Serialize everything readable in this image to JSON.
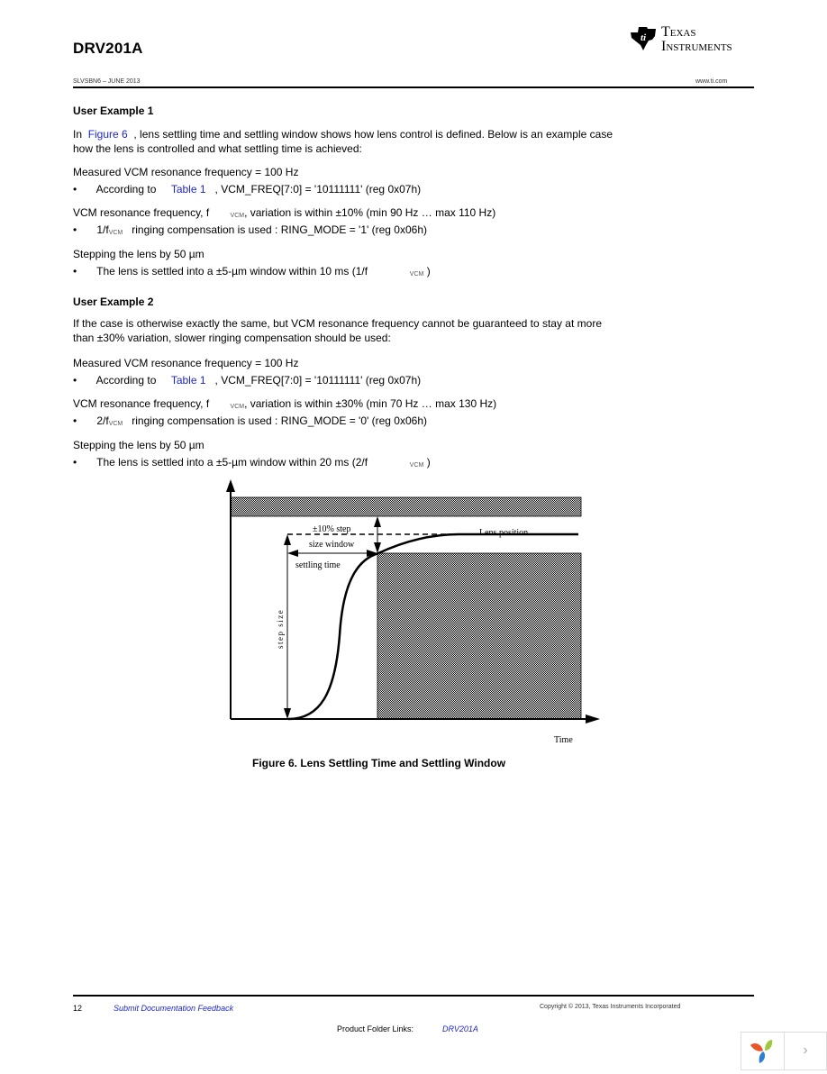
{
  "header": {
    "title": "DRV201A",
    "doc_id": "SLVSBN6 – JUNE 2013",
    "website": "www.ti.com",
    "logo": {
      "icon": "ti-logo-icon",
      "line1": "Texas",
      "line2": "Instruments"
    }
  },
  "example1": {
    "heading": "User Example 1",
    "intro_pre": "In",
    "intro_link": "Figure 6",
    "intro_post": ", lens settling time and settling window shows how lens control is defined. Below is an example case",
    "intro_line2": "how the lens is controlled and what settling time is achieved:",
    "measured": "Measured VCM resonance frequency = 100 Hz",
    "bullet1_pre": "According to",
    "bullet1_link": "Table 1",
    "bullet1_post": ", VCM_FREQ[7:0] = '10111111' (reg 0x07h)",
    "variation_pre": "VCM resonance frequency, f",
    "variation_sub": "VCM",
    "variation_post": ", variation is within ±10% (min 90 Hz … max 110 Hz)",
    "bullet2_pre": "1/f",
    "bullet2_sub": "VCM",
    "bullet2_post": "ringing compensation is used : RING_MODE = '1' (reg 0x06h)",
    "stepping": "Stepping the lens by 50 µm",
    "bullet3_pre": "The lens is settled into a ±5-µm window within 10 ms (1/f",
    "bullet3_sub": "VCM",
    "bullet3_post": ")"
  },
  "example2": {
    "heading": "User Example 2",
    "intro_line1": "If the case is otherwise exactly the same, but VCM resonance frequency cannot be guaranteed to stay at more",
    "intro_line2": "than ±30% variation, slower ringing compensation should be used:",
    "measured": "Measured VCM resonance frequency = 100 Hz",
    "bullet1_pre": "According to",
    "bullet1_link": "Table 1",
    "bullet1_post": ", VCM_FREQ[7:0] = '10111111' (reg 0x07h)",
    "variation_pre": "VCM resonance frequency, f",
    "variation_sub": "VCM",
    "variation_post": ", variation is within ±30% (min 70 Hz … max 130 Hz)",
    "bullet2_pre": "2/f",
    "bullet2_sub": "VCM",
    "bullet2_post": "ringing compensation is used : RING_MODE = '0' (reg 0x06h)",
    "stepping": "Stepping the lens by 50 µm",
    "bullet3_pre": "The lens is settled into a ±5-µm window within 20 ms (2/f",
    "bullet3_sub": "VCM",
    "bullet3_post": ")"
  },
  "bullet_char": "•",
  "figure": {
    "labels": {
      "step_window_line1": "±10% step",
      "step_window_line2": "size window",
      "settling_time": "settling time",
      "lens_position": "Lens position",
      "step_size": "step size",
      "x_axis": "Time"
    },
    "caption": "Figure 6. Lens Settling Time and Settling Window",
    "hatch_color": "#000000"
  },
  "footer": {
    "page_number": "12",
    "feedback_link": "Submit Documentation Feedback",
    "copyright": "Copyright © 2013, Texas Instruments Incorporated",
    "product_folder_label": "Product Folder Links:",
    "product_folder_link": "DRV201A"
  },
  "viewer_widget": {
    "logo_icon": "app-logo-icon",
    "next_icon": "›"
  }
}
